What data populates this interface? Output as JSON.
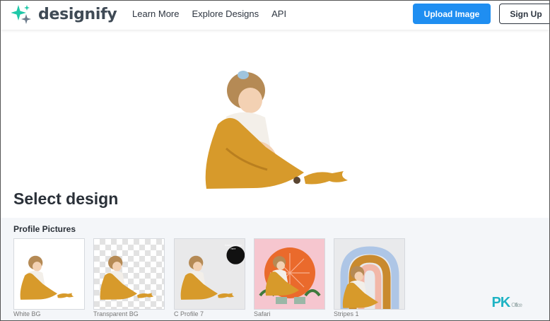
{
  "header": {
    "logo_text": "designify",
    "nav": [
      "Learn More",
      "Explore Designs",
      "API"
    ],
    "upload_label": "Upload Image",
    "signup_label": "Sign Up"
  },
  "main": {
    "title": "Select design"
  },
  "gallery": {
    "section_label": "Profile Pictures",
    "cards": [
      {
        "label": "White BG"
      },
      {
        "label": "Transparent BG"
      },
      {
        "label": "C Profile 7",
        "badge": "Insert your logo here"
      },
      {
        "label": "Safari"
      },
      {
        "label": "Stripes 1"
      }
    ]
  },
  "watermark": "PK",
  "watermark_small": "Office",
  "colors": {
    "primary": "#1f8ef1",
    "text_dark": "#2a3038",
    "gallery_bg": "#f4f6f9",
    "dress": "#d79a2b",
    "safari_bg": "#f6c6cf",
    "safari_sun": "#ea6a2c"
  }
}
